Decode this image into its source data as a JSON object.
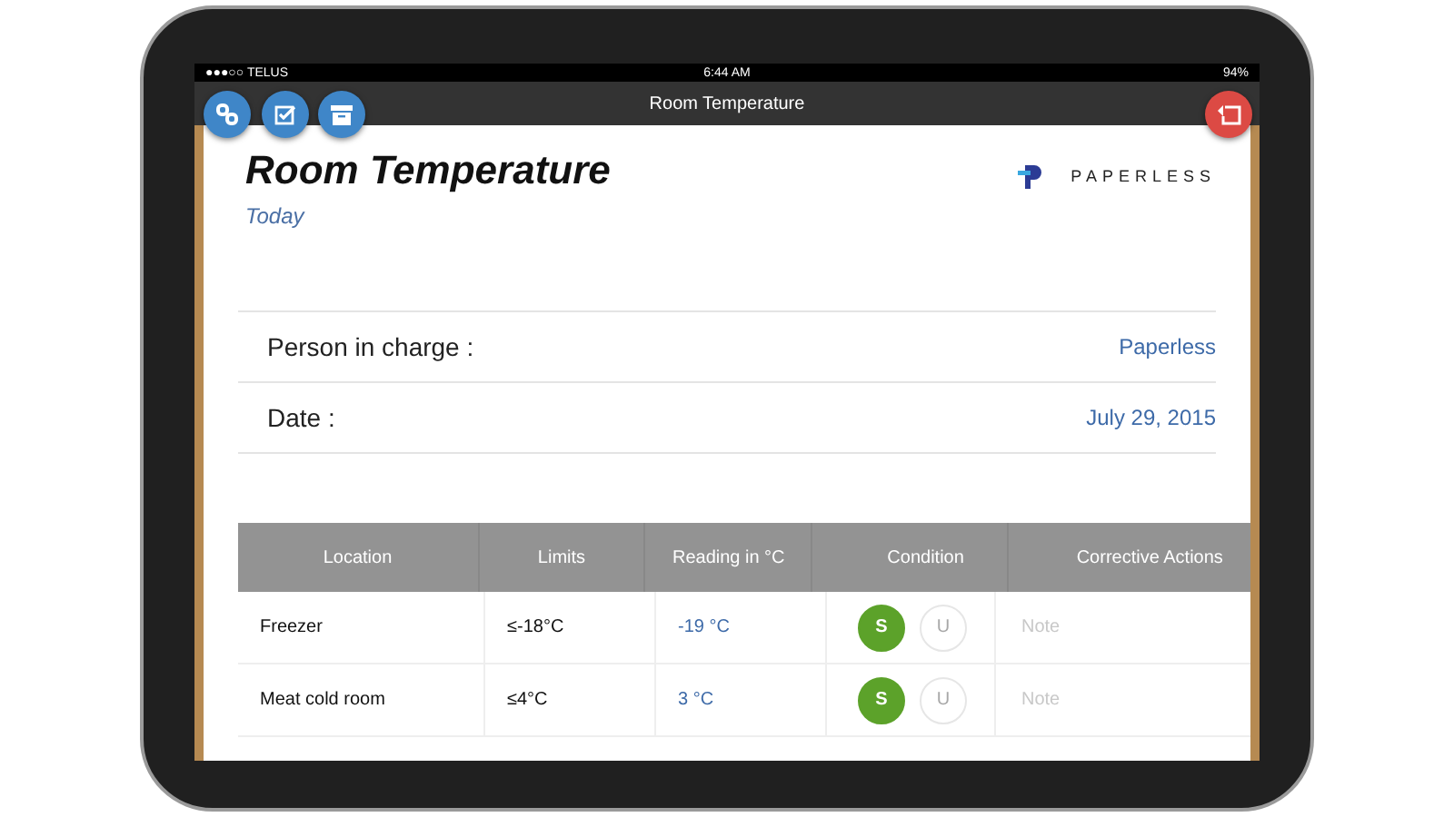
{
  "status_bar": {
    "carrier": "●●●○○ TELUS",
    "time": "6:44 AM",
    "battery": "94%"
  },
  "nav_bar": {
    "title": "Room Temperature"
  },
  "header": {
    "title": "Room Temperature",
    "subtitle": "Today",
    "logo_text": "PAPERLESS"
  },
  "fields": [
    {
      "label": "Person in charge :",
      "value": "Paperless"
    },
    {
      "label": "Date :",
      "value": "July 29, 2015"
    }
  ],
  "table": {
    "columns": [
      "Location",
      "Limits",
      "Reading in °C",
      "Condition",
      "Corrective Actions"
    ],
    "rows": [
      {
        "location": "Freezer",
        "limits": "≤-18°C",
        "reading": "-19 °C",
        "condition": [
          {
            "label": "S",
            "selected": true
          },
          {
            "label": "U",
            "selected": false
          }
        ],
        "note_placeholder": "Note"
      },
      {
        "location": "Meat cold room",
        "limits": "≤4°C",
        "reading": "3 °C",
        "condition": [
          {
            "label": "S",
            "selected": true
          },
          {
            "label": "U",
            "selected": false
          }
        ],
        "note_placeholder": "Note"
      }
    ]
  }
}
